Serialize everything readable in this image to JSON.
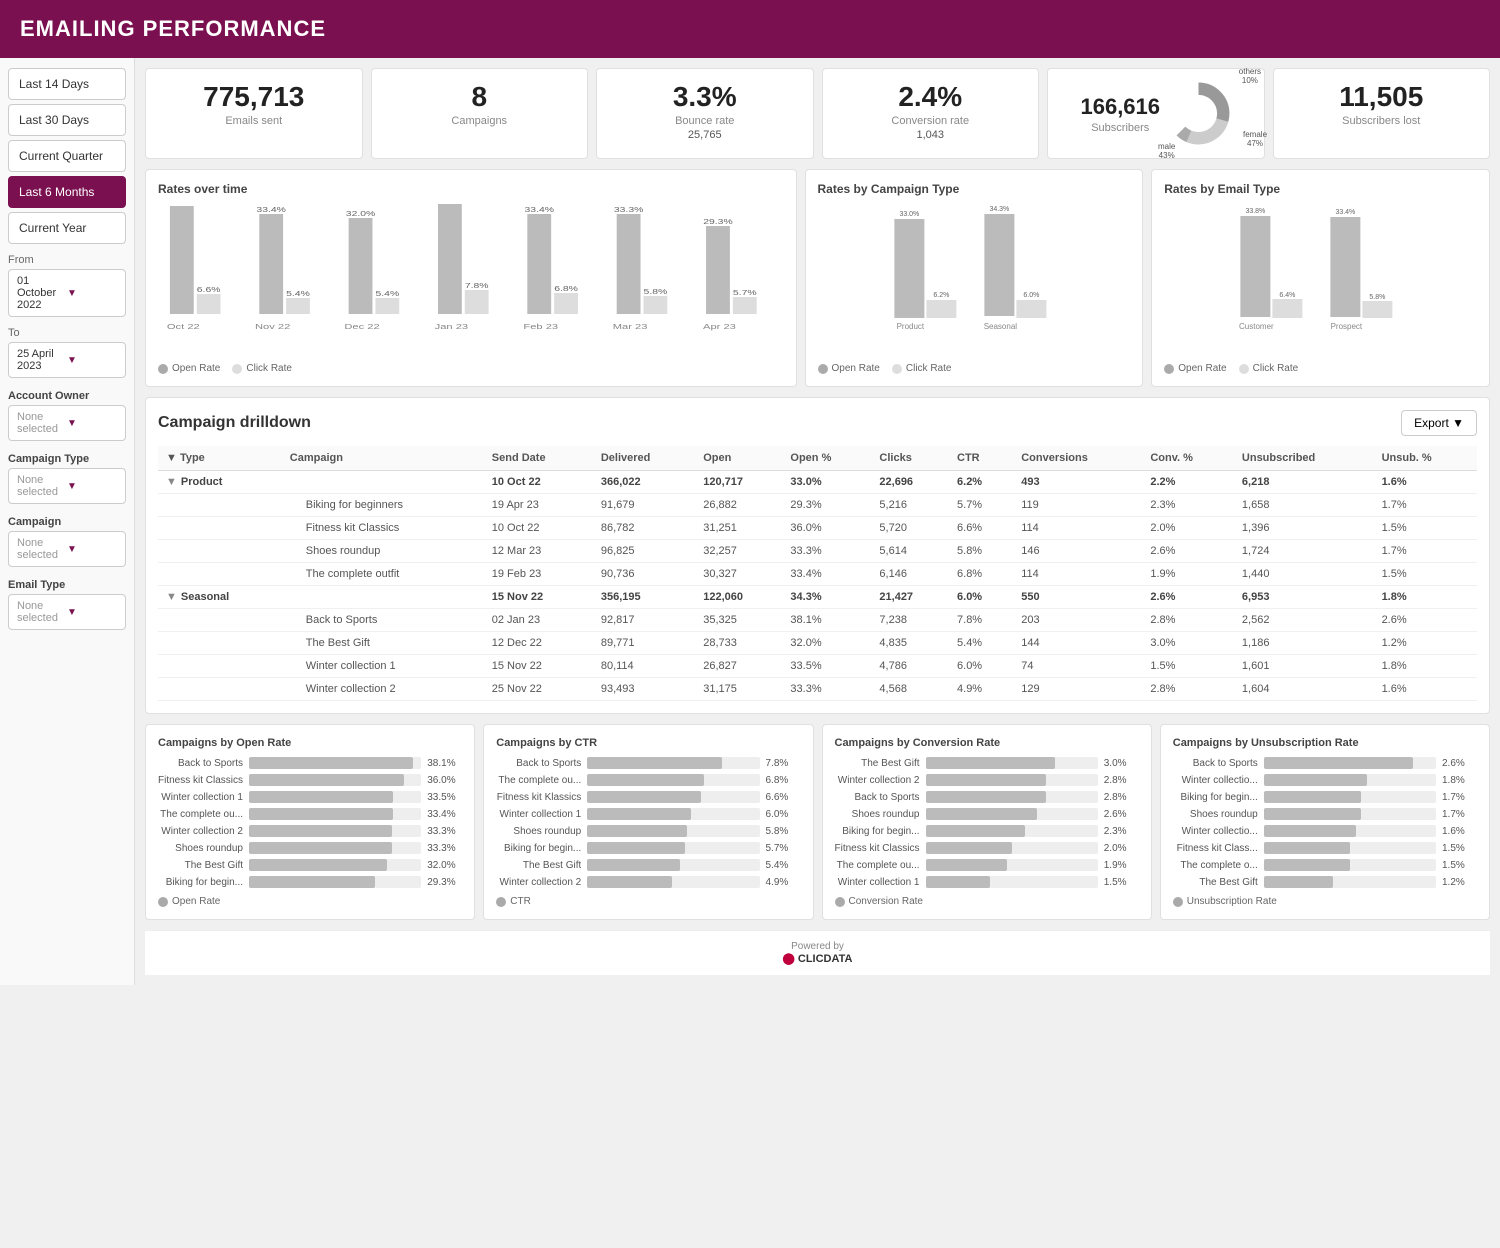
{
  "header": {
    "title": "EMAILING PERFORMANCE"
  },
  "sidebar": {
    "buttons": [
      {
        "label": "Last 14 Days",
        "active": false
      },
      {
        "label": "Last 30 Days",
        "active": false
      },
      {
        "label": "Current Quarter",
        "active": false
      },
      {
        "label": "Last 6 Months",
        "active": true
      },
      {
        "label": "Current Year",
        "active": false
      }
    ],
    "from_label": "From",
    "from_value": "01 October 2022",
    "to_label": "To",
    "to_value": "25 April 2023",
    "filters": [
      {
        "label": "Account Owner",
        "value": "None selected"
      },
      {
        "label": "Campaign Type",
        "value": "None selected"
      },
      {
        "label": "Campaign",
        "value": "None selected"
      },
      {
        "label": "Email Type",
        "value": "None selected"
      }
    ]
  },
  "kpis": [
    {
      "value": "775,713",
      "label": "Emails sent",
      "sub": ""
    },
    {
      "value": "8",
      "label": "Campaigns",
      "sub": ""
    },
    {
      "value": "3.3%",
      "label": "Bounce rate",
      "sub": "25,765"
    },
    {
      "value": "2.4%",
      "label": "Conversion rate",
      "sub": "1,043"
    },
    {
      "value": "166,616",
      "label": "Subscribers",
      "sub": "",
      "has_donut": true
    },
    {
      "value": "11,505",
      "label": "Subscribers lost",
      "sub": ""
    }
  ],
  "donut": {
    "female_pct": 47,
    "male_pct": 43,
    "others_pct": 10,
    "female_label": "female 47%",
    "male_label": "male 43%",
    "others_label": "others 10%"
  },
  "rates_over_time": {
    "title": "Rates over time",
    "months": [
      "Oct 22",
      "Nov 22",
      "Dec 22",
      "Jan 23",
      "Feb 23",
      "Mar 23",
      "Apr 23"
    ],
    "open_rates": [
      36.0,
      33.4,
      32.0,
      38.1,
      33.4,
      33.3,
      29.3
    ],
    "click_rates": [
      6.6,
      5.4,
      5.4,
      7.8,
      6.8,
      5.8,
      5.7
    ],
    "legend_open": "Open Rate",
    "legend_click": "Click Rate"
  },
  "rates_by_campaign": {
    "title": "Rates by Campaign Type",
    "types": [
      "Product",
      "Seasonal"
    ],
    "open_rates": [
      33.0,
      34.3
    ],
    "click_rates": [
      6.2,
      6.0
    ],
    "legend_open": "Open Rate",
    "legend_click": "Click Rate"
  },
  "rates_by_email": {
    "title": "Rates by Email Type",
    "types": [
      "Customer",
      "Prospect"
    ],
    "open_rates": [
      33.8,
      33.4
    ],
    "click_rates": [
      6.4,
      5.8
    ],
    "legend_open": "Open Rate",
    "legend_click": "Click Rate"
  },
  "drilldown": {
    "title": "Campaign drilldown",
    "export_label": "Export",
    "columns": [
      "Type",
      "Campaign",
      "Send Date",
      "Delivered",
      "Open",
      "Open %",
      "Clicks",
      "CTR",
      "Conversions",
      "Conv. %",
      "Unsubscribed",
      "Unsub. %"
    ],
    "groups": [
      {
        "type": "Product",
        "send_date": "10 Oct 22",
        "delivered": "366,022",
        "open": "120,717",
        "open_pct": "33.0%",
        "clicks": "22,696",
        "ctr": "6.2%",
        "conversions": "493",
        "conv_pct": "2.2%",
        "unsub": "6,218",
        "unsub_pct": "1.6%",
        "campaigns": [
          {
            "name": "Biking for beginners",
            "send_date": "19 Apr 23",
            "delivered": "91,679",
            "open": "26,882",
            "open_pct": "29.3%",
            "clicks": "5,216",
            "ctr": "5.7%",
            "conversions": "119",
            "conv_pct": "2.3%",
            "unsub": "1,658",
            "unsub_pct": "1.7%"
          },
          {
            "name": "Fitness kit Classics",
            "send_date": "10 Oct 22",
            "delivered": "86,782",
            "open": "31,251",
            "open_pct": "36.0%",
            "clicks": "5,720",
            "ctr": "6.6%",
            "conversions": "114",
            "conv_pct": "2.0%",
            "unsub": "1,396",
            "unsub_pct": "1.5%"
          },
          {
            "name": "Shoes roundup",
            "send_date": "12 Mar 23",
            "delivered": "96,825",
            "open": "32,257",
            "open_pct": "33.3%",
            "clicks": "5,614",
            "ctr": "5.8%",
            "conversions": "146",
            "conv_pct": "2.6%",
            "unsub": "1,724",
            "unsub_pct": "1.7%"
          },
          {
            "name": "The complete outfit",
            "send_date": "19 Feb 23",
            "delivered": "90,736",
            "open": "30,327",
            "open_pct": "33.4%",
            "clicks": "6,146",
            "ctr": "6.8%",
            "conversions": "114",
            "conv_pct": "1.9%",
            "unsub": "1,440",
            "unsub_pct": "1.5%"
          }
        ]
      },
      {
        "type": "Seasonal",
        "send_date": "15 Nov 22",
        "delivered": "356,195",
        "open": "122,060",
        "open_pct": "34.3%",
        "clicks": "21,427",
        "ctr": "6.0%",
        "conversions": "550",
        "conv_pct": "2.6%",
        "unsub": "6,953",
        "unsub_pct": "1.8%",
        "campaigns": [
          {
            "name": "Back to Sports",
            "send_date": "02 Jan 23",
            "delivered": "92,817",
            "open": "35,325",
            "open_pct": "38.1%",
            "clicks": "7,238",
            "ctr": "7.8%",
            "conversions": "203",
            "conv_pct": "2.8%",
            "unsub": "2,562",
            "unsub_pct": "2.6%"
          },
          {
            "name": "The Best Gift",
            "send_date": "12 Dec 22",
            "delivered": "89,771",
            "open": "28,733",
            "open_pct": "32.0%",
            "clicks": "4,835",
            "ctr": "5.4%",
            "conversions": "144",
            "conv_pct": "3.0%",
            "unsub": "1,186",
            "unsub_pct": "1.2%"
          },
          {
            "name": "Winter collection 1",
            "send_date": "15 Nov 22",
            "delivered": "80,114",
            "open": "26,827",
            "open_pct": "33.5%",
            "clicks": "4,786",
            "ctr": "6.0%",
            "conversions": "74",
            "conv_pct": "1.5%",
            "unsub": "1,601",
            "unsub_pct": "1.8%"
          },
          {
            "name": "Winter collection 2",
            "send_date": "25 Nov 22",
            "delivered": "93,493",
            "open": "31,175",
            "open_pct": "33.3%",
            "clicks": "4,568",
            "ctr": "4.9%",
            "conversions": "129",
            "conv_pct": "2.8%",
            "unsub": "1,604",
            "unsub_pct": "1.6%"
          }
        ]
      }
    ]
  },
  "campaigns_open_rate": {
    "title": "Campaigns by Open Rate",
    "legend": "Open Rate",
    "items": [
      {
        "label": "Back to Sports",
        "value": 38.1,
        "display": "38.1%"
      },
      {
        "label": "Fitness kit Classics",
        "value": 36.0,
        "display": "36.0%"
      },
      {
        "label": "Winter collection 1",
        "value": 33.5,
        "display": "33.5%"
      },
      {
        "label": "The complete ou...",
        "value": 33.4,
        "display": "33.4%"
      },
      {
        "label": "Winter collection 2",
        "value": 33.3,
        "display": "33.3%"
      },
      {
        "label": "Shoes roundup",
        "value": 33.3,
        "display": "33.3%"
      },
      {
        "label": "The Best Gift",
        "value": 32.0,
        "display": "32.0%"
      },
      {
        "label": "Biking for begin...",
        "value": 29.3,
        "display": "29.3%"
      }
    ],
    "max": 40
  },
  "campaigns_ctr": {
    "title": "Campaigns by CTR",
    "legend": "CTR",
    "items": [
      {
        "label": "Back to Sports",
        "value": 7.8,
        "display": "7.8%"
      },
      {
        "label": "The complete ou...",
        "value": 6.8,
        "display": "6.8%"
      },
      {
        "label": "Fitness kit Klassics",
        "value": 6.6,
        "display": "6.6%"
      },
      {
        "label": "Winter collection 1",
        "value": 6.0,
        "display": "6.0%"
      },
      {
        "label": "Shoes roundup",
        "value": 5.8,
        "display": "5.8%"
      },
      {
        "label": "Biking for begin...",
        "value": 5.7,
        "display": "5.7%"
      },
      {
        "label": "The Best Gift",
        "value": 5.4,
        "display": "5.4%"
      },
      {
        "label": "Winter collection 2",
        "value": 4.9,
        "display": "4.9%"
      }
    ],
    "max": 10
  },
  "campaigns_conversion": {
    "title": "Campaigns by Conversion Rate",
    "legend": "Conversion Rate",
    "items": [
      {
        "label": "The Best Gift",
        "value": 3.0,
        "display": "3.0%"
      },
      {
        "label": "Winter collection 2",
        "value": 2.8,
        "display": "2.8%"
      },
      {
        "label": "Back to Sports",
        "value": 2.8,
        "display": "2.8%"
      },
      {
        "label": "Shoes roundup",
        "value": 2.6,
        "display": "2.6%"
      },
      {
        "label": "Biking for begin...",
        "value": 2.3,
        "display": "2.3%"
      },
      {
        "label": "Fitness kit Classics",
        "value": 2.0,
        "display": "2.0%"
      },
      {
        "label": "The complete ou...",
        "value": 1.9,
        "display": "1.9%"
      },
      {
        "label": "Winter collection 1",
        "value": 1.5,
        "display": "1.5%"
      }
    ],
    "max": 4
  },
  "campaigns_unsub": {
    "title": "Campaigns by Unsubscription Rate",
    "legend": "Unsubscription Rate",
    "items": [
      {
        "label": "Back to Sports",
        "value": 2.6,
        "display": "2.6%"
      },
      {
        "label": "Winter collectio...",
        "value": 1.8,
        "display": "1.8%"
      },
      {
        "label": "Biking for begin...",
        "value": 1.7,
        "display": "1.7%"
      },
      {
        "label": "Shoes roundup",
        "value": 1.7,
        "display": "1.7%"
      },
      {
        "label": "Winter collectio...",
        "value": 1.6,
        "display": "1.6%"
      },
      {
        "label": "Fitness kit Class...",
        "value": 1.5,
        "display": "1.5%"
      },
      {
        "label": "The complete o...",
        "value": 1.5,
        "display": "1.5%"
      },
      {
        "label": "The Best Gift",
        "value": 1.2,
        "display": "1.2%"
      }
    ],
    "max": 3
  },
  "footer": {
    "powered_by": "Powered by",
    "brand": "CLICDATA"
  }
}
